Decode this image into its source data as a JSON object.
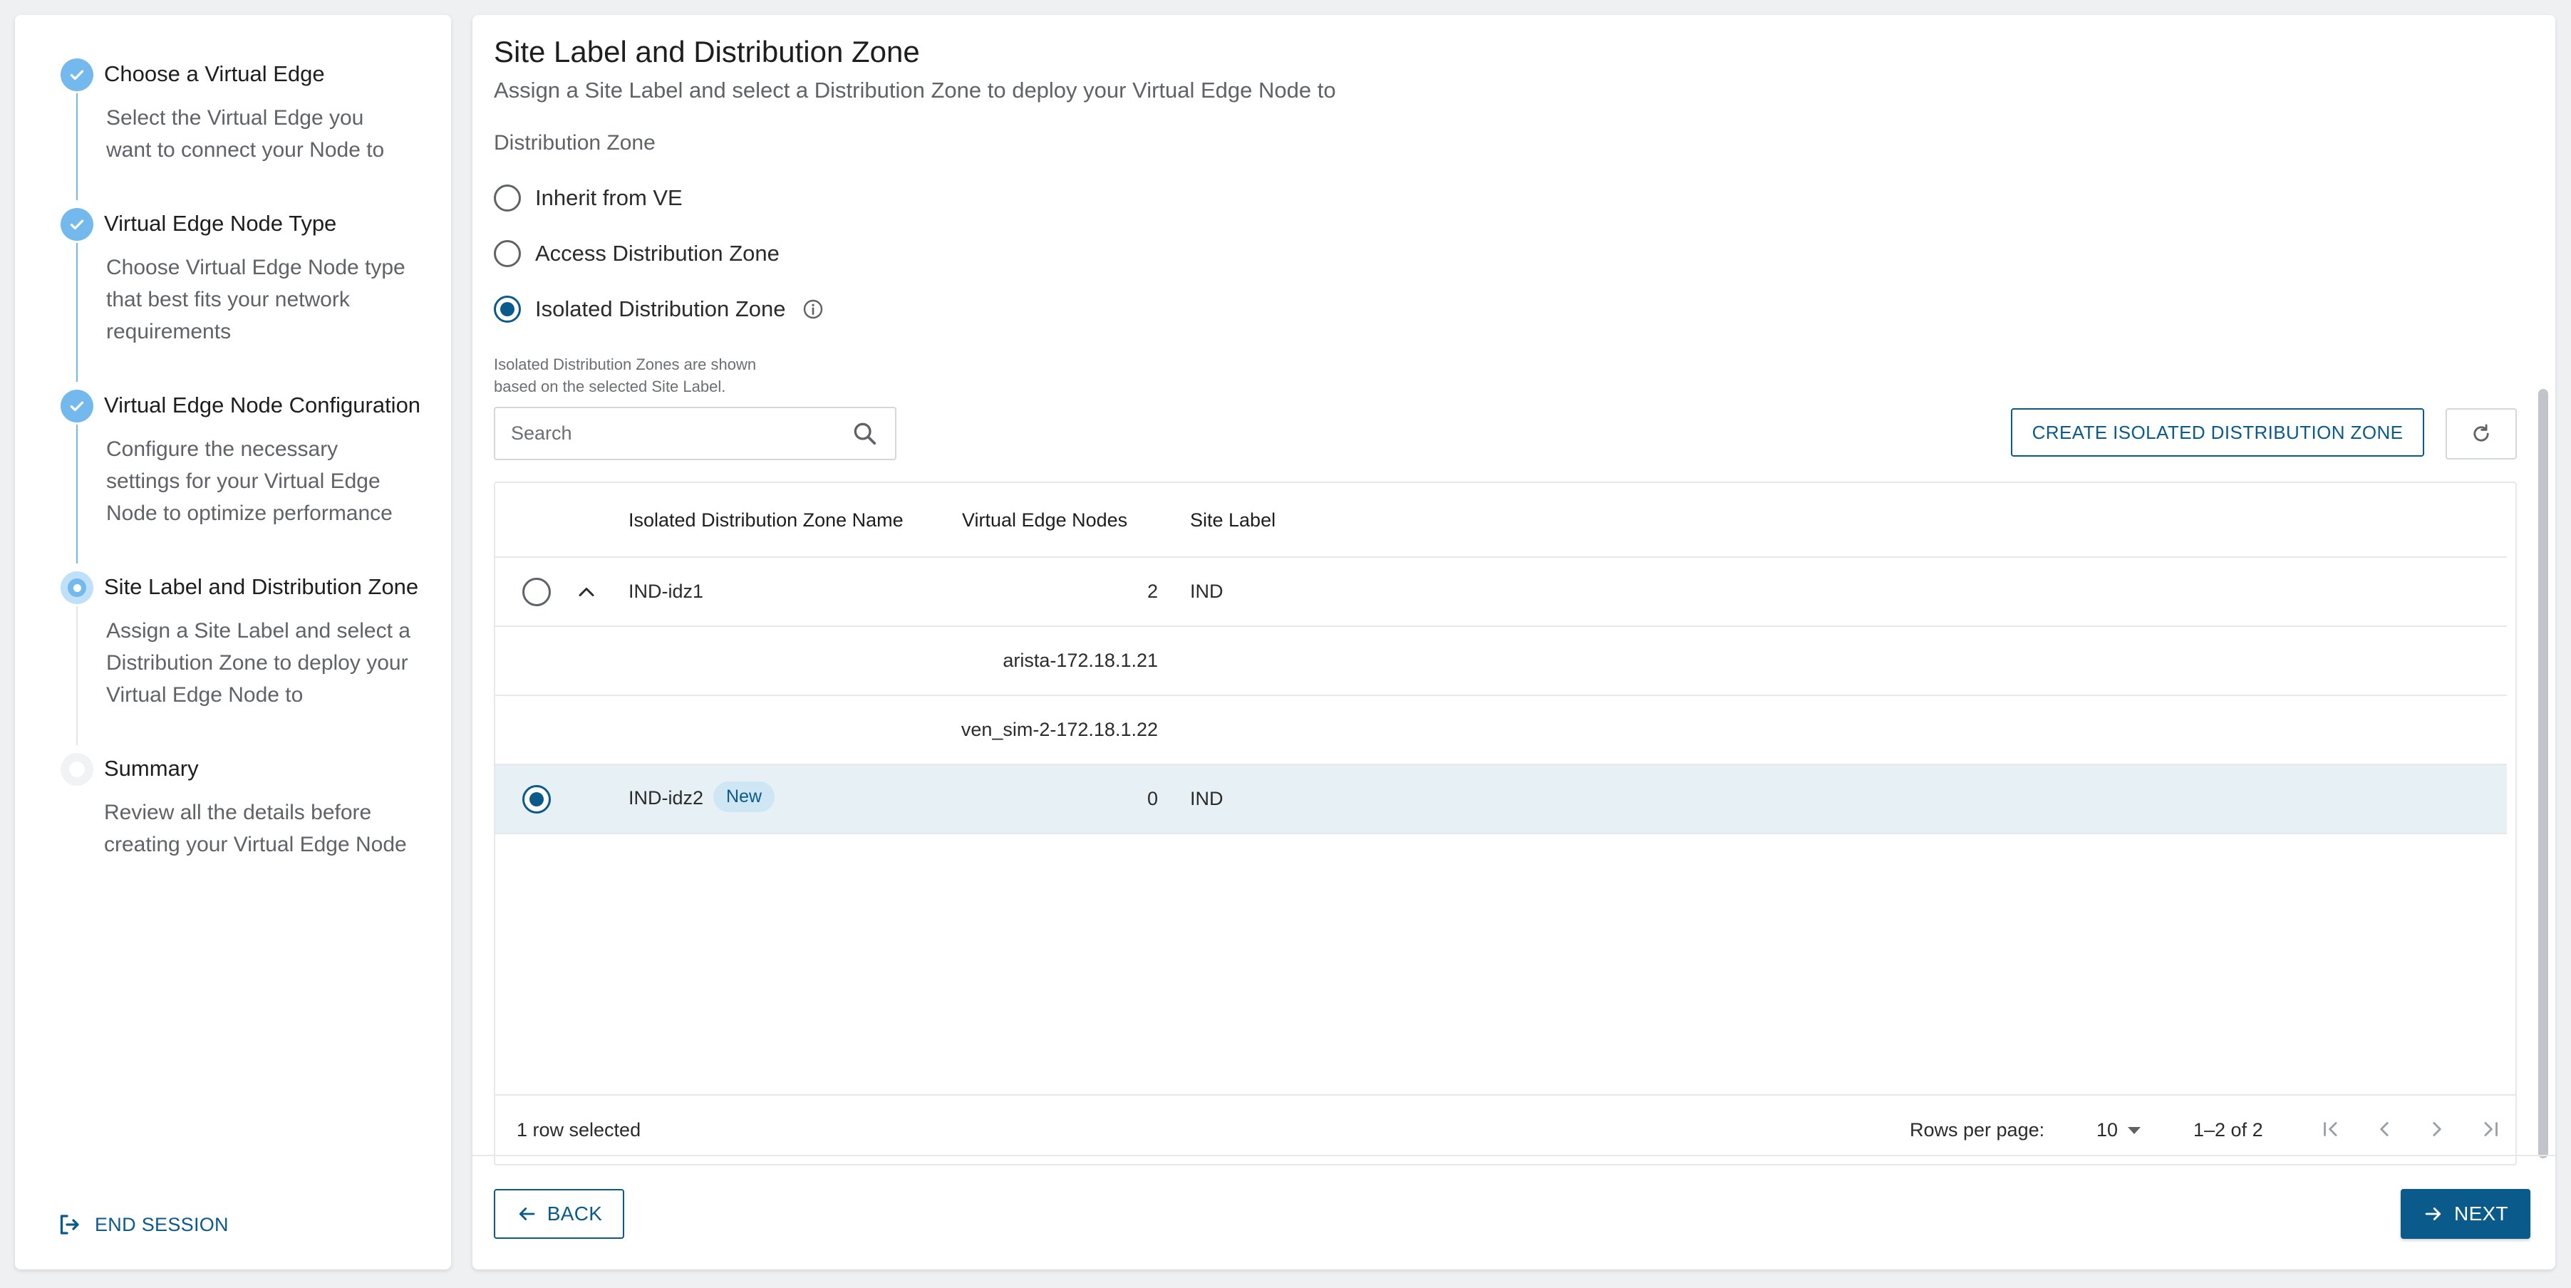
{
  "stepper": {
    "steps": [
      {
        "title": "Choose a Virtual Edge",
        "desc_lines": [
          "Select the Virtual Edge you",
          "want to connect your Node to"
        ],
        "state": "done"
      },
      {
        "title": "Virtual Edge Node Type",
        "desc_lines": [
          "Choose Virtual Edge Node type",
          "that best fits your network",
          "requirements"
        ],
        "state": "done"
      },
      {
        "title": "Virtual Edge Node Configuration",
        "desc_lines": [
          "Configure the necessary",
          "settings for your Virtual Edge",
          "Node to optimize performance"
        ],
        "state": "done"
      },
      {
        "title": "Site Label and Distribution Zone",
        "desc_lines": [
          "Assign a Site Label and select a",
          "Distribution Zone to deploy your",
          "Virtual Edge Node to"
        ],
        "state": "active"
      },
      {
        "title": "Summary",
        "desc_lines": [
          "Review all the details before",
          "creating your Virtual Edge Node"
        ],
        "state": "todo"
      }
    ],
    "end_session_label": "END SESSION"
  },
  "main": {
    "title": "Site Label and Distribution Zone",
    "subtitle": "Assign a Site Label and select a Distribution Zone to deploy your Virtual Edge Node to",
    "dz_label": "Distribution Zone",
    "options": [
      {
        "label": "Inherit from VE",
        "checked": false
      },
      {
        "label": "Access Distribution Zone",
        "checked": false
      },
      {
        "label": "Isolated Distribution Zone",
        "checked": true
      }
    ],
    "help_lines": [
      "Isolated Distribution Zones are shown",
      "based on the selected Site Label."
    ],
    "search_placeholder": "Search",
    "create_button": "CREATE ISOLATED DISTRIBUTION ZONE",
    "table": {
      "columns": [
        "Isolated Distribution Zone Name",
        "Virtual Edge Nodes",
        "Site Label"
      ],
      "rows": [
        {
          "name": "IND-idz1",
          "nodes": "2",
          "site": "IND",
          "selected": false,
          "expanded": true,
          "badge": ""
        },
        {
          "name": "",
          "nodes": "arista-172.18.1.21",
          "site": "",
          "child": true
        },
        {
          "name": "",
          "nodes": "ven_sim-2-172.18.1.22",
          "site": "",
          "child": true
        },
        {
          "name": "IND-idz2",
          "nodes": "0",
          "site": "IND",
          "selected": true,
          "badge": "New"
        }
      ],
      "footer": {
        "selected_text": "1 row selected",
        "rows_per_page_label": "Rows per page:",
        "rows_per_page_value": "10",
        "range_text": "1–2 of 2"
      }
    },
    "back_label": "BACK",
    "next_label": "NEXT"
  },
  "colors": {
    "accent": "#0a5a8c",
    "step_done": "#73b9ee",
    "selected_row": "#e7f0f5",
    "badge_bg": "#cfe6f5"
  }
}
